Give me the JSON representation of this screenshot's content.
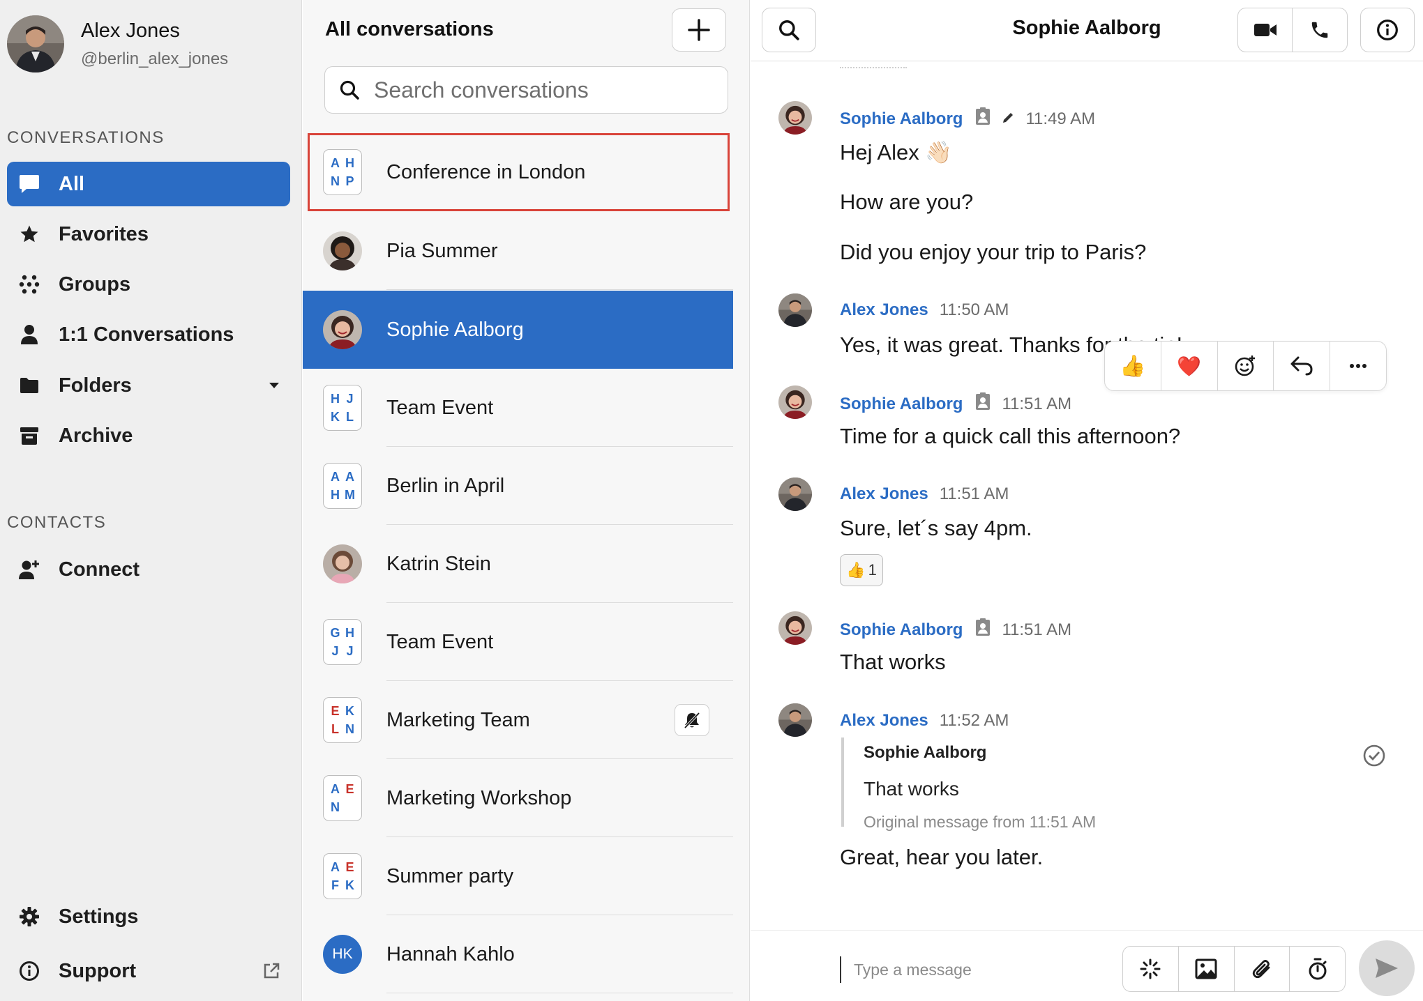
{
  "user": {
    "name": "Alex Jones",
    "handle": "@berlin_alex_jones"
  },
  "sidebar": {
    "conversations_heading": "CONVERSATIONS",
    "items": [
      {
        "label": "All",
        "icon": "chat-bubble-icon",
        "active": true
      },
      {
        "label": "Favorites",
        "icon": "star-icon"
      },
      {
        "label": "Groups",
        "icon": "groups-dots-icon"
      },
      {
        "label": "1:1 Conversations",
        "icon": "person-icon"
      },
      {
        "label": "Folders",
        "icon": "folder-icon"
      },
      {
        "label": "Archive",
        "icon": "archive-icon"
      }
    ],
    "contacts_heading": "CONTACTS",
    "connect_label": "Connect",
    "settings_label": "Settings",
    "support_label": "Support"
  },
  "conv_list": {
    "title": "All conversations",
    "search_placeholder": "Search conversations",
    "items": [
      {
        "name": "Conference in London",
        "type": "group",
        "letters": [
          "A",
          "H",
          "N",
          "P"
        ],
        "highlighted": true
      },
      {
        "name": "Pia Summer",
        "type": "person"
      },
      {
        "name": "Sophie Aalborg",
        "type": "person",
        "active": true
      },
      {
        "name": "Team Event",
        "type": "group",
        "letters": [
          "H",
          "J",
          "K",
          "L"
        ]
      },
      {
        "name": "Berlin in April",
        "type": "group",
        "letters": [
          "A",
          "A",
          "H",
          "M"
        ]
      },
      {
        "name": "Katrin Stein",
        "type": "person"
      },
      {
        "name": "Team Event",
        "type": "group",
        "letters": [
          "G",
          "H",
          "J",
          "J"
        ]
      },
      {
        "name": "Marketing Team",
        "type": "group",
        "letters": [
          "E",
          "K",
          "L",
          "N"
        ],
        "muted": true
      },
      {
        "name": "Marketing Workshop",
        "type": "group",
        "letters": [
          "A",
          "E",
          "N",
          ""
        ]
      },
      {
        "name": "Summer party",
        "type": "group",
        "letters": [
          "A",
          "E",
          "F",
          "K"
        ]
      },
      {
        "name": "Hannah Kahlo",
        "type": "initials",
        "initials": "HK"
      }
    ]
  },
  "chat": {
    "title": "Sophie Aalborg",
    "messages": [
      {
        "author": "Sophie Aalborg",
        "time": "11:49 AM",
        "lines": [
          "Hej Alex 👋🏻",
          "How are you?",
          "Did you enjoy your trip to Paris?"
        ]
      },
      {
        "author": "Alex Jones",
        "time": "11:50 AM",
        "lines": [
          "Yes, it was great. Thanks for the tip!"
        ]
      },
      {
        "author": "Sophie Aalborg",
        "time": "11:51 AM",
        "lines": [
          "Time for a quick call this afternoon?"
        ]
      },
      {
        "author": "Alex Jones",
        "time": "11:51 AM",
        "lines": [
          "Sure, let´s say 4pm."
        ],
        "reaction": {
          "emoji": "👍",
          "count": "1"
        }
      },
      {
        "author": "Sophie Aalborg",
        "time": "11:51 AM",
        "lines": [
          "That works"
        ]
      },
      {
        "author": "Alex Jones",
        "time": "11:52 AM",
        "quote": {
          "author": "Sophie Aalborg",
          "text": "That works",
          "original": "Original message from 11:51 AM"
        },
        "lines": [
          "Great, hear you later."
        ]
      }
    ],
    "reactions": [
      "👍",
      "❤️"
    ],
    "composer_placeholder": "Type a message"
  },
  "colors": {
    "accent": "#2b6cc4",
    "highlight_border": "#d9443a",
    "group_letter_blue": "#2b6cc4",
    "group_letter_red": "#c8322a"
  }
}
